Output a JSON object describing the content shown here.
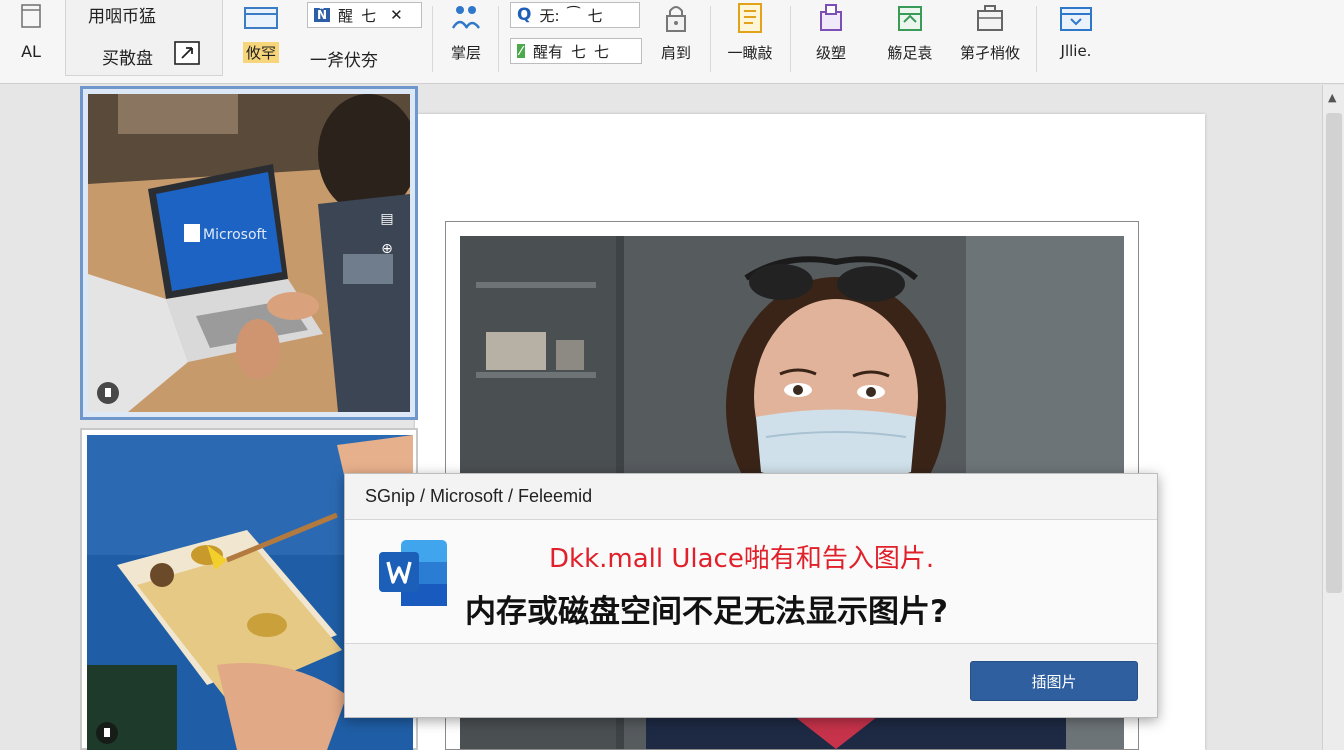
{
  "ribbon": {
    "left_group": {
      "top_label": "用咽币猛",
      "bottom_label": "买散盘",
      "small_icon_label": "AL"
    },
    "highlight_label": "攸罕",
    "chip_top": {
      "icon_text": "Ñ",
      "text": "醒",
      "suffix": "七",
      "close": "✕"
    },
    "group_label_1": "一斧伏夯",
    "button_layer": "掌层",
    "chip_style_top": {
      "icon_text": "Q",
      "text": "无:",
      "mid": "⁀",
      "suffix": "七"
    },
    "chip_style_bottom": {
      "icon_text": "⁄",
      "text": "醒有",
      "suffix1": "七",
      "suffix2": "七"
    },
    "button_lock": "肩到",
    "button_text": "一瞰敲",
    "button_bookmark": "级塑",
    "button_shape": "觞足袁",
    "button_gallery": "第孑梢攸",
    "button_more": "Jllie."
  },
  "thumbnails": [
    {
      "selected": true
    },
    {
      "selected": false
    }
  ],
  "thumb_tools": {
    "delete": "▤",
    "lock": "⊕"
  },
  "dialog": {
    "title": "SGnip / Microsoft / Feleemid",
    "message_red": "Dkk.mall Ulace啪有和告入图片.",
    "message_main": "内存或磁盘空间不足无法显示图片?",
    "ok_label": "插图片"
  },
  "colors": {
    "selection": "#6f97cc",
    "word_blue": "#185abd",
    "ok_button": "#2f5f9f",
    "error_text": "#e0202a"
  }
}
